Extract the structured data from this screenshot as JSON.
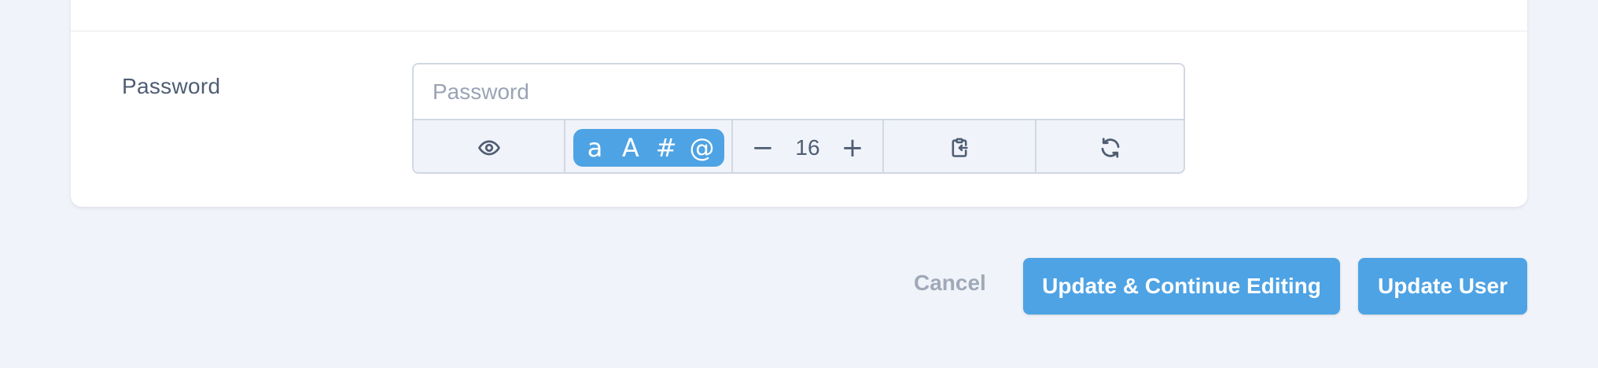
{
  "form": {
    "password_label": "Password",
    "password_placeholder": "Password",
    "password_value": ""
  },
  "password_tools": {
    "show_icon": "eye-icon",
    "charset": {
      "lowercase": "a",
      "uppercase": "A",
      "digits": "#",
      "symbols": "@",
      "selected_color": "#4ea3e4"
    },
    "length": {
      "decrement": "−",
      "value": "16",
      "increment": "+"
    },
    "copy_icon": "clipboard-icon",
    "regenerate_icon": "refresh-icon"
  },
  "actions": {
    "cancel_label": "Cancel",
    "update_continue_label": "Update & Continue Editing",
    "update_label": "Update User",
    "primary_color": "#4ea3e4"
  }
}
